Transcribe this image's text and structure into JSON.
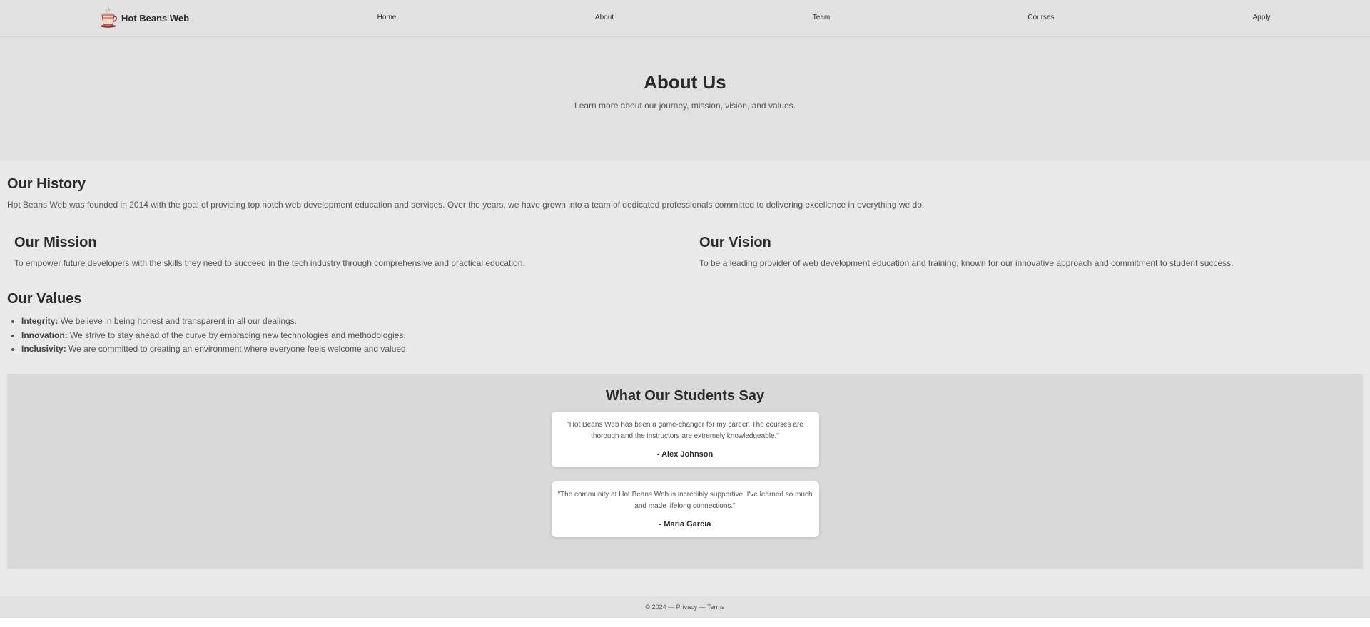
{
  "navbar": {
    "brand": "Hot Beans Web",
    "logo_icon": "coffee-cup-icon",
    "links": [
      "Home",
      "About",
      "Team",
      "Courses",
      "Apply"
    ]
  },
  "hero": {
    "title": "About Us",
    "subtitle": "Learn more about our journey, mission, vision, and values."
  },
  "history": {
    "title": "Our History",
    "text": "Hot Beans Web was founded in 2014 with the goal of providing top notch web development education and services. Over the years, we have grown into a team of dedicated professionals committed to delivering excellence in everything we do."
  },
  "mission": {
    "title": "Our Mission",
    "text": "To empower future developers with the skills they need to succeed in the tech industry through comprehensive and practical education."
  },
  "vision": {
    "title": "Our Vision",
    "text": "To be a leading provider of web development education and training, known for our innovative approach and commitment to student success."
  },
  "values": {
    "title": "Our Values",
    "items": [
      {
        "label": "Integrity:",
        "text": " We believe in being honest and transparent in all our dealings."
      },
      {
        "label": "Innovation:",
        "text": " We strive to stay ahead of the curve by embracing new technologies and methodologies."
      },
      {
        "label": "Inclusivity:",
        "text": " We are committed to creating an environment where everyone feels welcome and valued."
      }
    ]
  },
  "testimonials": {
    "title": "What Our Students Say",
    "items": [
      {
        "quote": "\"Hot Beans Web has been a game-changer for my career. The courses are thorough and the instructors are extremely knowledgeable.\"",
        "author": "- Alex Johnson"
      },
      {
        "quote": "\"The community at Hot Beans Web is incredibly supportive. I've learned so much and made lifelong connections.\"",
        "author": "- Maria Garcia"
      }
    ]
  },
  "footer": {
    "text": "© 2024 — Privacy — Terms"
  },
  "colors": {
    "header_bg": "#e1e1e1",
    "main_bg": "#e9e9e9",
    "testimonials_bg": "#d9d9d9",
    "heading": "#2b2b2b",
    "body_text": "#555555"
  }
}
